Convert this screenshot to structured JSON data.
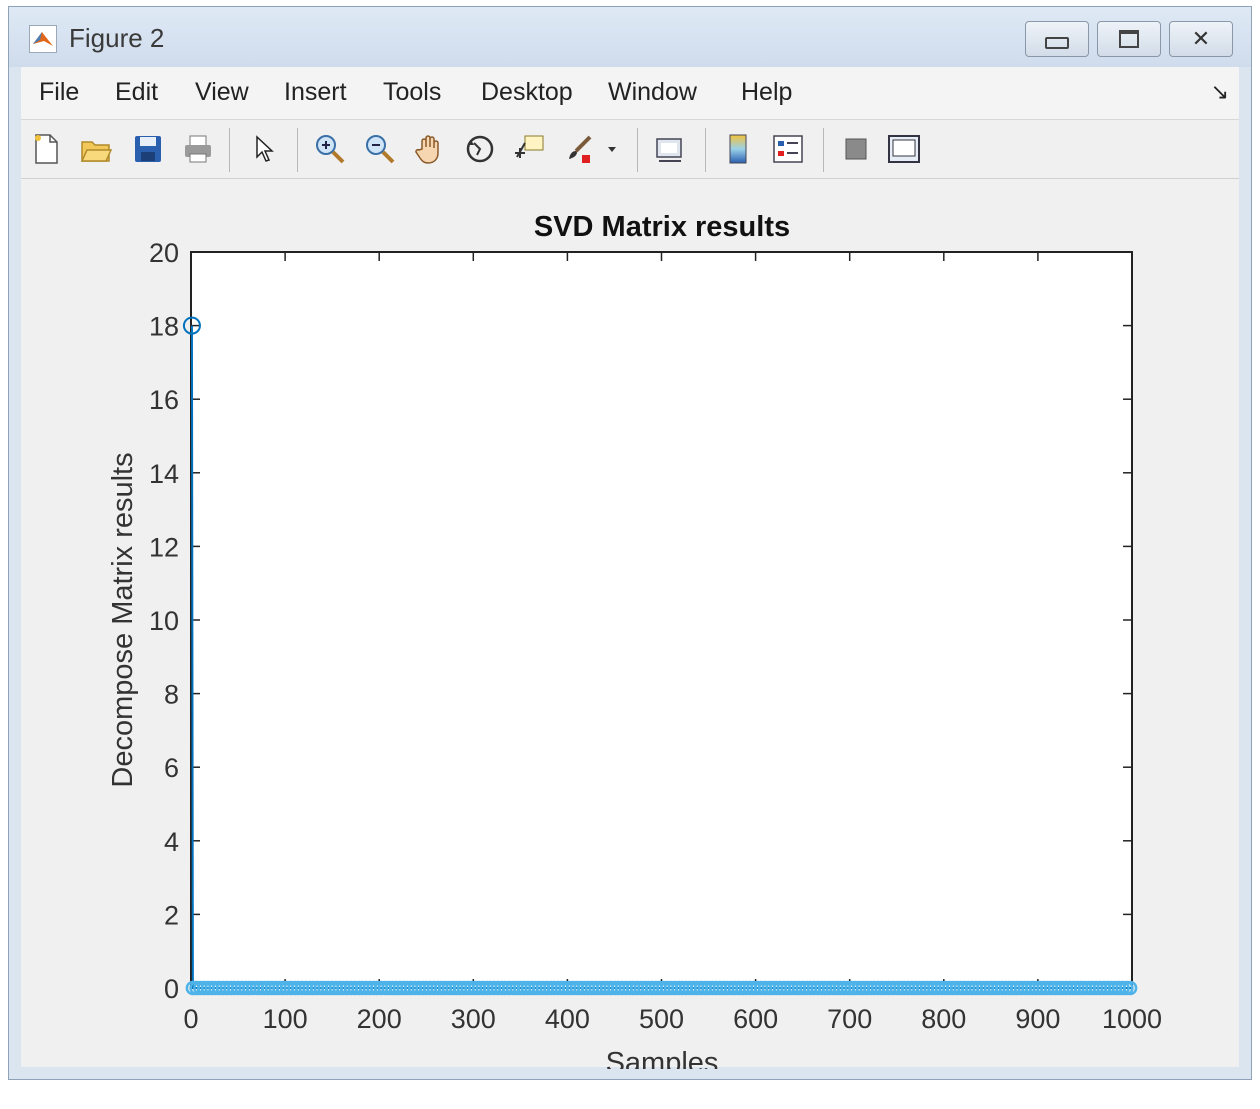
{
  "window": {
    "title": "Figure 2",
    "controls": [
      {
        "name": "minimize",
        "glyph": "▭"
      },
      {
        "name": "maximize",
        "glyph": "□"
      },
      {
        "name": "close",
        "glyph": "✕"
      }
    ]
  },
  "menubar": {
    "items": [
      "File",
      "Edit",
      "View",
      "Insert",
      "Tools",
      "Desktop",
      "Window",
      "Help"
    ],
    "dock_glyph": "↘"
  },
  "toolbar": {
    "buttons": [
      "new-figure-icon",
      "open-file-icon",
      "save-icon",
      "print-icon",
      "pointer-icon",
      "zoom-in-icon",
      "zoom-out-icon",
      "pan-hand-icon",
      "rotate-3d-icon",
      "data-cursor-icon",
      "brush-icon",
      "brush-dropdown-icon",
      "link-plot-icon",
      "colorbar-icon",
      "legend-icon",
      "hide-plot-tools-icon",
      "show-plot-tools-icon"
    ]
  },
  "chart_data": {
    "type": "line",
    "title": "SVD Matrix results",
    "xlabel": "Samples",
    "ylabel": "Decompose Matrix results",
    "xlim": [
      0,
      1000
    ],
    "ylim": [
      0,
      20
    ],
    "xticks": [
      "0",
      "100",
      "200",
      "300",
      "400",
      "500",
      "600",
      "700",
      "800",
      "900",
      "1000"
    ],
    "yticks": [
      "0",
      "2",
      "4",
      "6",
      "8",
      "10",
      "12",
      "14",
      "16",
      "18",
      "20"
    ],
    "series": [
      {
        "marker": "circle",
        "color": "#0072bd",
        "points": [
          [
            1,
            18
          ],
          [
            2,
            0
          ],
          [
            1000,
            0
          ]
        ],
        "note_marker_run": "markers at every sample from 2 to 1000 with value 0"
      }
    ],
    "grid": false
  }
}
